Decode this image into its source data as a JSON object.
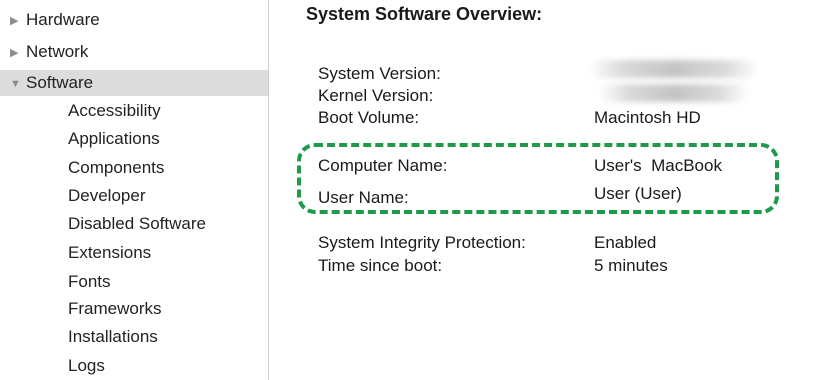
{
  "sidebar": {
    "categories": [
      {
        "label": "Hardware",
        "expanded": false
      },
      {
        "label": "Network",
        "expanded": false
      },
      {
        "label": "Software",
        "expanded": true,
        "selected": true
      }
    ],
    "software_items": [
      "Accessibility",
      "Applications",
      "Components",
      "Developer",
      "Disabled Software",
      "Extensions",
      "Fonts",
      "Frameworks",
      "Installations",
      "Logs"
    ]
  },
  "main": {
    "title": "System Software Overview:",
    "rows": [
      {
        "label": "System Version:",
        "value": "",
        "redacted": true
      },
      {
        "label": "Kernel Version:",
        "value": "",
        "redacted": true
      },
      {
        "label": "Boot Volume:",
        "value": "Macintosh HD"
      },
      {
        "label": "Computer Name:",
        "value": "User's  MacBook"
      },
      {
        "label": "User Name:",
        "value": "User (User)"
      },
      {
        "label": "System Integrity Protection:",
        "value": "Enabled"
      },
      {
        "label": "Time since boot:",
        "value": "5 minutes"
      }
    ]
  },
  "highlight_color": "#1e9a4a",
  "selection_color": "#dcdcdc"
}
